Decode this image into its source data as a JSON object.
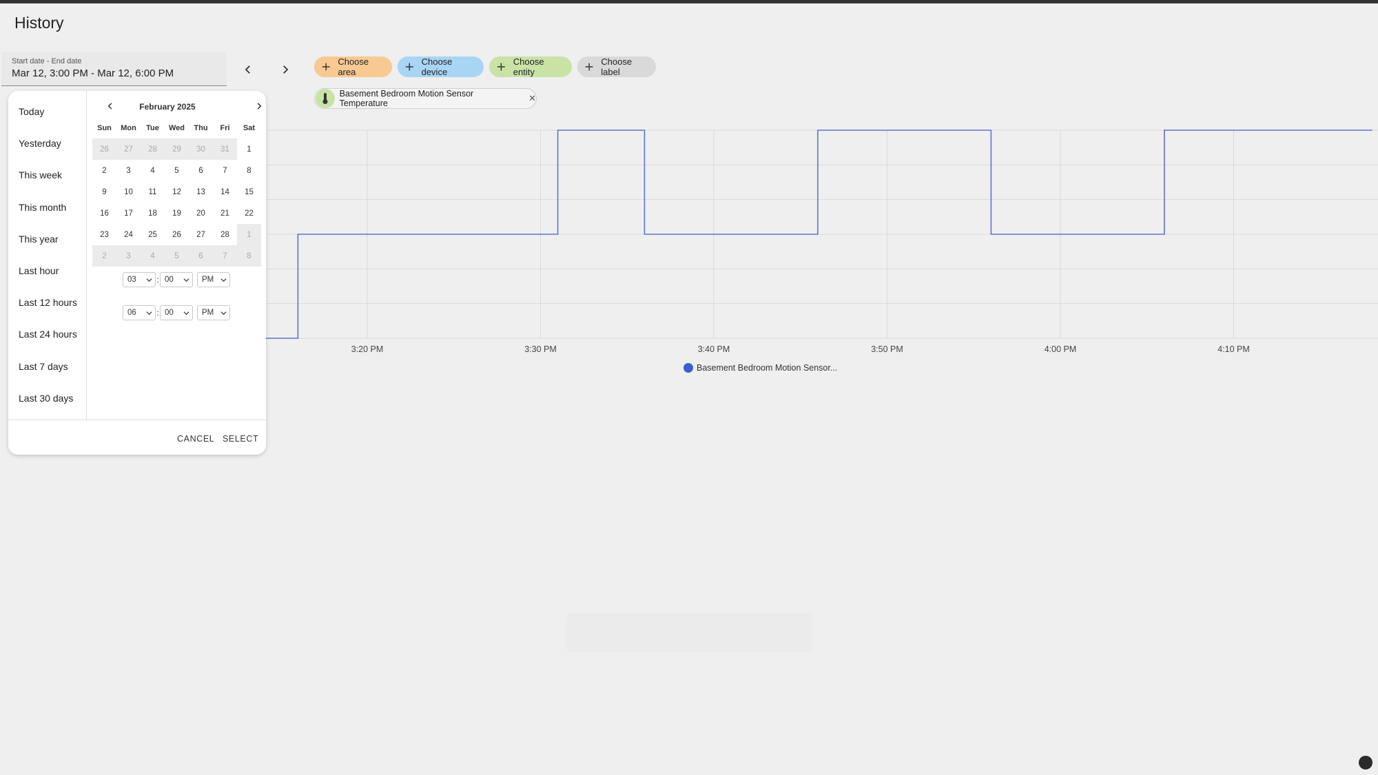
{
  "page": {
    "title": "History"
  },
  "date_range": {
    "label": "Start date - End date",
    "value": "Mar 12, 3:00 PM - Mar 12, 6:00 PM"
  },
  "targets": {
    "area": "Choose area",
    "device": "Choose device",
    "entity": "Choose entity",
    "label": "Choose label"
  },
  "selected_entity": {
    "name": "Basement Bedroom Motion Sensor Temperature",
    "remove": "✕"
  },
  "picker": {
    "ranges": [
      "Today",
      "Yesterday",
      "This week",
      "This month",
      "This year",
      "Last hour",
      "Last 12 hours",
      "Last 24 hours",
      "Last 7 days",
      "Last 30 days"
    ],
    "month_label": "February 2025",
    "weekdays": [
      "Sun",
      "Mon",
      "Tue",
      "Wed",
      "Thu",
      "Fri",
      "Sat"
    ],
    "days": [
      [
        "26",
        "27",
        "28",
        "29",
        "30",
        "31",
        "1"
      ],
      [
        "2",
        "3",
        "4",
        "5",
        "6",
        "7",
        "8"
      ],
      [
        "9",
        "10",
        "11",
        "12",
        "13",
        "14",
        "15"
      ],
      [
        "16",
        "17",
        "18",
        "19",
        "20",
        "21",
        "22"
      ],
      [
        "23",
        "24",
        "25",
        "26",
        "27",
        "28",
        "1"
      ],
      [
        "2",
        "3",
        "4",
        "5",
        "6",
        "7",
        "8"
      ]
    ],
    "out_of_month": [
      [
        0,
        0
      ],
      [
        0,
        1
      ],
      [
        0,
        2
      ],
      [
        0,
        3
      ],
      [
        0,
        4
      ],
      [
        0,
        5
      ],
      [
        4,
        6
      ],
      [
        5,
        0
      ],
      [
        5,
        1
      ],
      [
        5,
        2
      ],
      [
        5,
        3
      ],
      [
        5,
        4
      ],
      [
        5,
        5
      ],
      [
        5,
        6
      ]
    ],
    "start_time": {
      "hour": "03",
      "minute": "00",
      "ampm": "PM"
    },
    "end_time": {
      "hour": "06",
      "minute": "00",
      "ampm": "PM"
    },
    "colon": ":",
    "cancel_label": "CANCEL",
    "select_label": "SELECT"
  },
  "chart_data": {
    "type": "line",
    "step": true,
    "series": [
      {
        "name": "Basement Bedroom Motion Sensor...",
        "color": "#5b73d4",
        "points": [
          [
            "3:16 PM",
            0
          ],
          [
            "3:16 PM",
            1
          ],
          [
            "3:31 PM",
            1
          ],
          [
            "3:31 PM",
            2
          ],
          [
            "3:36 PM",
            2
          ],
          [
            "3:36 PM",
            1
          ],
          [
            "3:46 PM",
            1
          ],
          [
            "3:46 PM",
            2
          ],
          [
            "3:56 PM",
            2
          ],
          [
            "3:56 PM",
            1
          ],
          [
            "4:06 PM",
            1
          ],
          [
            "4:06 PM",
            2
          ],
          [
            "4:18 PM",
            2
          ]
        ]
      }
    ],
    "x_ticks": [
      "3:20 PM",
      "3:30 PM",
      "3:40 PM",
      "3:50 PM",
      "4:00 PM",
      "4:10 PM"
    ],
    "grid": true,
    "legend": "bottom-center"
  }
}
